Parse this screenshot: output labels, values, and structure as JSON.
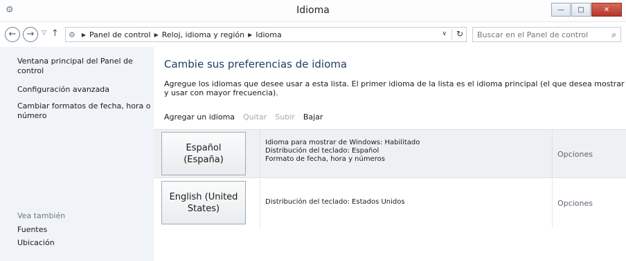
{
  "window": {
    "title": "Idioma",
    "icon": "control-panel-icon",
    "buttons": {
      "minimize": "—",
      "maximize": "□",
      "close": "✕"
    }
  },
  "nav": {
    "back": "←",
    "forward": "→",
    "up": "↑",
    "breadcrumbs": [
      "Panel de control",
      "Reloj, idioma y región",
      "Idioma"
    ],
    "search_placeholder": "Buscar en el Panel de control"
  },
  "sidebar": {
    "links": [
      "Ventana principal del Panel de control",
      "Configuración avanzada",
      "Cambiar formatos de fecha, hora o número"
    ],
    "see_also_heading": "Vea también",
    "see_also": [
      "Fuentes",
      "Ubicación"
    ]
  },
  "main": {
    "title": "Cambie sus preferencias de idioma",
    "description": "Agregue los idiomas que desee usar a esta lista. El primer idioma de la lista es el idioma principal (el que desea mostrar y usar con mayor frecuencia).",
    "toolbar": {
      "add": "Agregar un idioma",
      "remove": "Quitar",
      "up": "Subir",
      "down": "Bajar"
    },
    "languages": [
      {
        "name": "Español (España)",
        "details": [
          "Idioma para mostrar de Windows: Habilitado",
          "Distribución del teclado: Español",
          "Formato de fecha, hora y números"
        ],
        "options": "Opciones"
      },
      {
        "name": "English (United States)",
        "details": [
          "Distribución del teclado: Estados Unidos"
        ],
        "options": "Opciones"
      }
    ]
  },
  "colors": {
    "sidebar_bg": "#f0f3f7",
    "title_blue": "#1e3a5f",
    "selected_row": "#eef0f2"
  }
}
